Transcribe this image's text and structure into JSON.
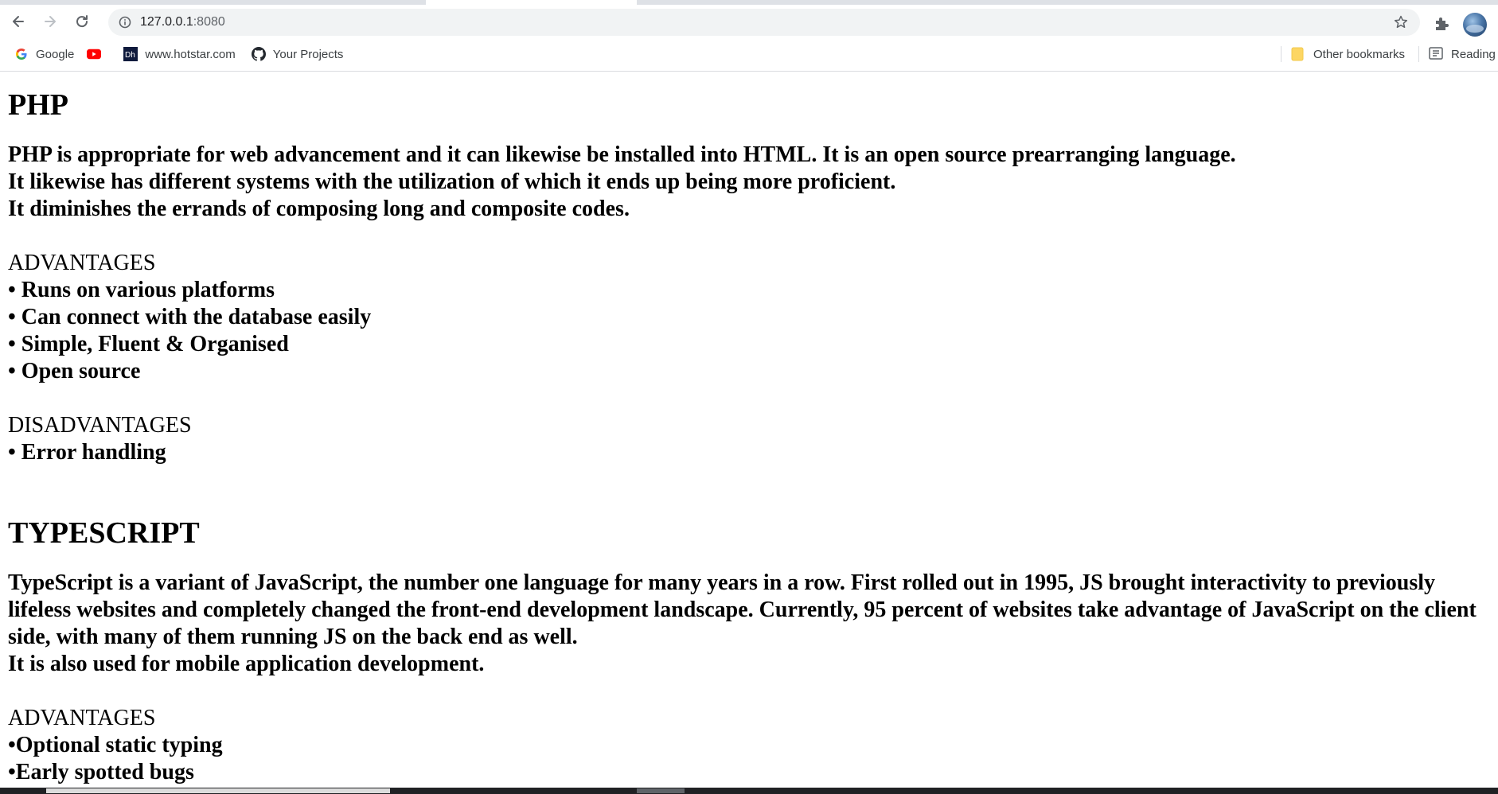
{
  "browser": {
    "url_host": "127.0.0.1",
    "url_port": ":8080",
    "bookmarks": [
      {
        "label": "Google",
        "icon": "google-icon"
      },
      {
        "label": "",
        "icon": "youtube-icon"
      },
      {
        "label": "www.hotstar.com",
        "icon": "hotstar-icon"
      },
      {
        "label": "Your Projects",
        "icon": "github-icon"
      }
    ],
    "other_bookmarks": "Other bookmarks",
    "reading_list": "Reading",
    "colors": {
      "toolbar_bg": "#ffffff",
      "omnibox_bg": "#f1f3f4",
      "folder_yellow": "#fdd663"
    }
  },
  "page": {
    "sections": [
      {
        "title": "PHP",
        "intro_lines": [
          "PHP is appropriate for web advancement and it can likewise be installed into HTML. It is an open source prearranging language.",
          "It likewise has different systems with the utilization of which it ends up being more proficient.",
          "It diminishes the errands of composing long and composite codes."
        ],
        "advantages_label": "ADVANTAGES",
        "advantages": [
          "• Runs on various platforms",
          "• Can connect with the database easily",
          "• Simple, Fluent & Organised",
          "• Open source"
        ],
        "disadvantages_label": "DISADVANTAGES",
        "disadvantages": [
          "• Error handling"
        ]
      },
      {
        "title": "TYPESCRIPT",
        "intro_paragraph": "TypeScript is a variant of JavaScript, the number one language for many years in a row. First rolled out in 1995, JS brought interactivity to previously lifeless websites and completely changed the front-end development landscape. Currently, 95 percent of websites take advantage of JavaScript on the client side, with many of them running JS on the back end as well.",
        "intro_extra": "It is also used for mobile application development.",
        "advantages_label": "ADVANTAGES",
        "advantages": [
          "•Optional static typing",
          "•Early spotted bugs"
        ]
      }
    ]
  }
}
